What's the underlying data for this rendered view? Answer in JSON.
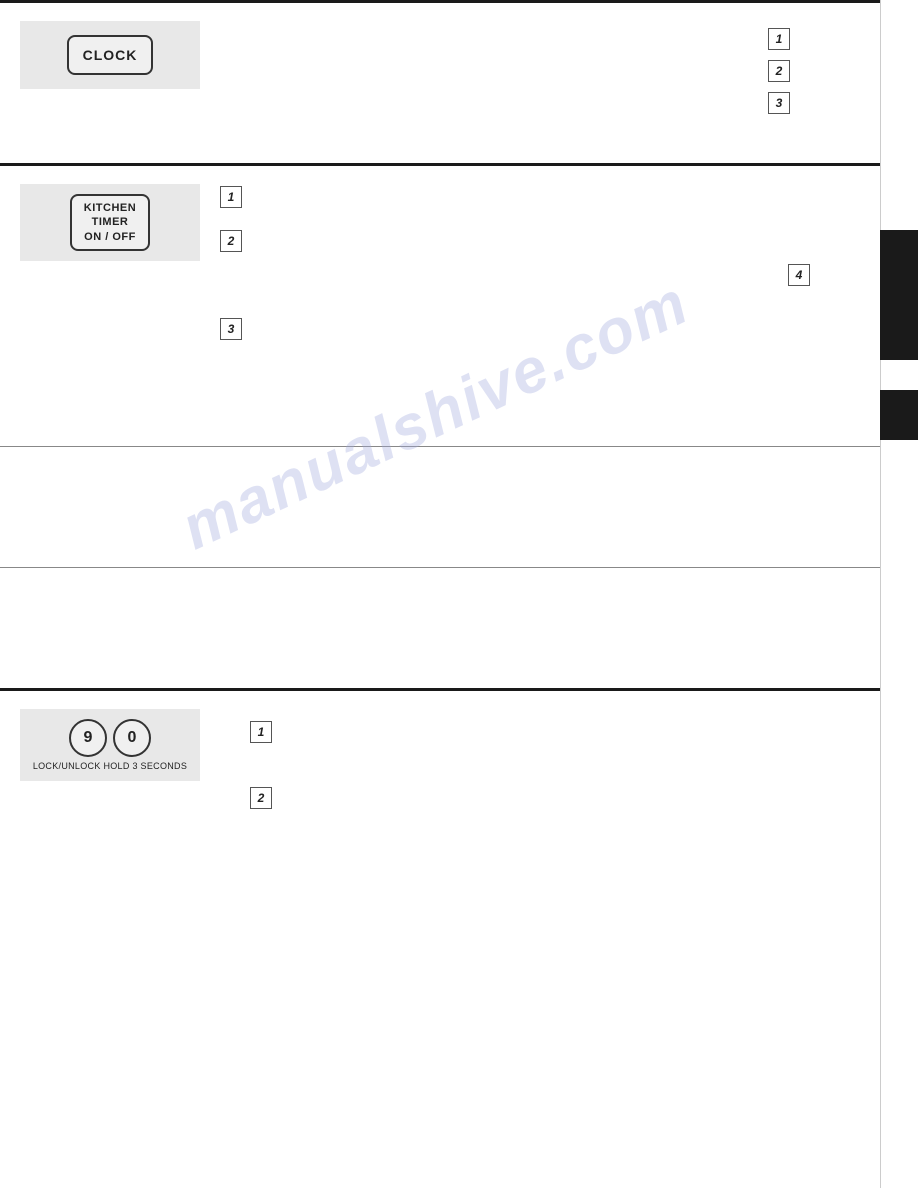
{
  "sections": {
    "clock": {
      "button_label": "CLOCK",
      "steps": [
        {
          "num": "1",
          "text": ""
        },
        {
          "num": "2",
          "text": ""
        },
        {
          "num": "3",
          "text": ""
        }
      ]
    },
    "kitchen_timer": {
      "button_line1": "KITCHEN",
      "button_line2": "TIMER",
      "button_line3": "ON / OFF",
      "steps": [
        {
          "num": "1",
          "text": ""
        },
        {
          "num": "2",
          "text": ""
        },
        {
          "num": "3",
          "text": ""
        },
        {
          "num": "4",
          "text": ""
        }
      ]
    },
    "plain1": {
      "text": ""
    },
    "plain2": {
      "text": ""
    },
    "lock": {
      "key1": "9",
      "key2": "0",
      "sub_label": "LOCK/UNLOCK HOLD 3 SECONDS",
      "steps": [
        {
          "num": "1",
          "text": ""
        },
        {
          "num": "2",
          "text": ""
        }
      ]
    }
  },
  "watermark": {
    "text": "manualshive.com"
  }
}
